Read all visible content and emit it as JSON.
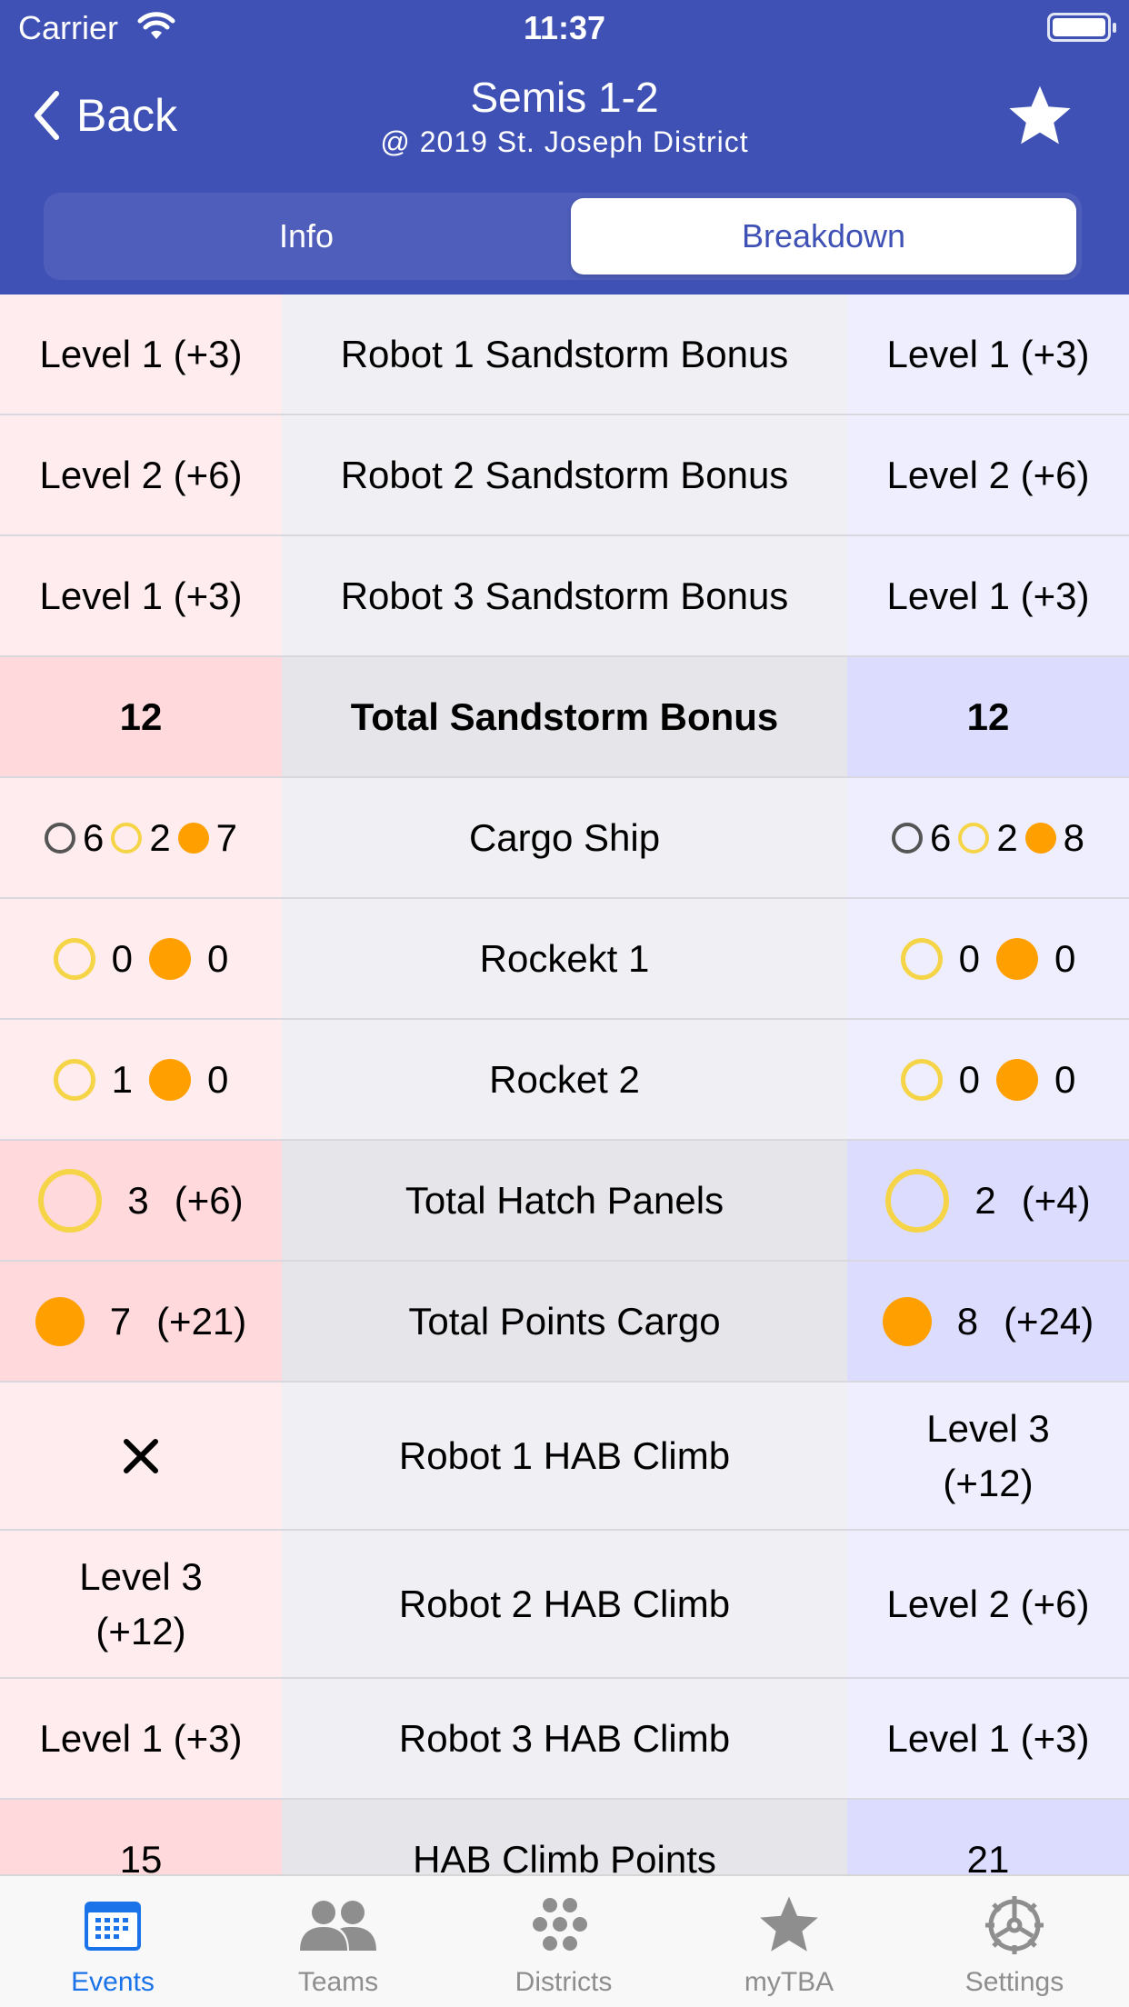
{
  "status_bar": {
    "carrier": "Carrier",
    "time": "11:37"
  },
  "nav": {
    "back_label": "Back",
    "title": "Semis 1-2",
    "subtitle": "@ 2019 St. Joseph District"
  },
  "segments": {
    "info": "Info",
    "breakdown": "Breakdown",
    "selected": "Breakdown"
  },
  "colors": {
    "header": "#3F51B5",
    "red_alliance_bg": "#FFECEE",
    "blue_alliance_bg": "#EEEEFF",
    "hatch_panel": "#F5D547",
    "cargo": "#FFA000",
    "active_tab": "#1a73e8"
  },
  "breakdown": {
    "r1_sandstorm": {
      "label": "Robot 1 Sandstorm Bonus",
      "red": "Level 1 (+3)",
      "blue": "Level 1 (+3)"
    },
    "r2_sandstorm": {
      "label": "Robot 2 Sandstorm Bonus",
      "red": "Level 2 (+6)",
      "blue": "Level 2 (+6)"
    },
    "r3_sandstorm": {
      "label": "Robot 3 Sandstorm Bonus",
      "red": "Level 1 (+3)",
      "blue": "Level 1 (+3)"
    },
    "total_sandstorm": {
      "label": "Total Sandstorm Bonus",
      "red": "12",
      "blue": "12"
    },
    "cargo_ship": {
      "label": "Cargo Ship",
      "red": {
        "null_panels": "6",
        "hatch_panels": "2",
        "cargo": "7"
      },
      "blue": {
        "null_panels": "6",
        "hatch_panels": "2",
        "cargo": "8"
      }
    },
    "rocket1": {
      "label": "Rockekt 1",
      "red": {
        "hatch_panels": "0",
        "cargo": "0"
      },
      "blue": {
        "hatch_panels": "0",
        "cargo": "0"
      }
    },
    "rocket2": {
      "label": "Rocket 2",
      "red": {
        "hatch_panels": "1",
        "cargo": "0"
      },
      "blue": {
        "hatch_panels": "0",
        "cargo": "0"
      }
    },
    "total_hatch": {
      "label": "Total Hatch Panels",
      "red": {
        "count": "3",
        "points": "(+6)"
      },
      "blue": {
        "count": "2",
        "points": "(+4)"
      }
    },
    "total_cargo": {
      "label": "Total Points Cargo",
      "red": {
        "count": "7",
        "points": "(+21)"
      },
      "blue": {
        "count": "8",
        "points": "(+24)"
      }
    },
    "r1_hab": {
      "label": "Robot 1 HAB Climb",
      "red_icon": "x-mark-icon",
      "blue": "Level 3 (+12)"
    },
    "r2_hab": {
      "label": "Robot 2 HAB Climb",
      "red": "Level 3 (+12)",
      "blue": "Level 2 (+6)"
    },
    "r3_hab": {
      "label": "Robot 3 HAB Climb",
      "red": "Level 1 (+3)",
      "blue": "Level 1 (+3)"
    },
    "hab_points": {
      "label": "HAB Climb Points",
      "red": "15",
      "blue": "21"
    }
  },
  "tabbar": {
    "events": "Events",
    "teams": "Teams",
    "districts": "Districts",
    "mytba": "myTBA",
    "settings": "Settings",
    "active": "Events"
  }
}
